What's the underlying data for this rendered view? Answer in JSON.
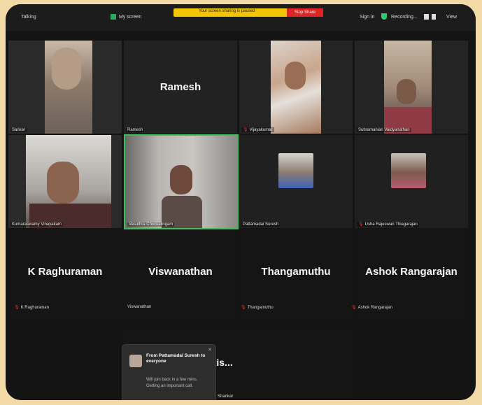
{
  "topbar": {
    "left_label": "Talking",
    "my_screen": "My screen",
    "share_notice": "Your screen sharing is paused",
    "stop_button": "Stop Share",
    "sign_in": "Sign in",
    "recording": "Recording...",
    "view": "View"
  },
  "row1": {
    "sankar": "Sankar",
    "ramesh_big": "Ramesh",
    "ramesh": "Ramesh",
    "vijayakumar": "Vijayakumar",
    "subramanian": "Subramanian Vaidyanathan"
  },
  "row2": {
    "kumaraswamy": "Kumaraswamy Vinayakam",
    "vasuthra": "Vasuthra Chockalingam",
    "pattamadai": "Pattamadai Suresh",
    "usha": "Usha Rajeswari Thiagarajan"
  },
  "row3": {
    "raghuraman_big": "K Raghuraman",
    "raghuraman": "K Raghuraman",
    "viswanathan_big": "Viswanathan",
    "viswanathan": "Viswanathan",
    "thangamuthu_big": "Thangamuthu",
    "thangamuthu": "Thangamuthu",
    "ashok_big": "Ashok Rangarajan",
    "ashok": "Ashok Rangarajan"
  },
  "row4": {
    "partial_big": "har  ramakris...",
    "partial": "Shankar"
  },
  "chat": {
    "from": "From Pattamadai Suresh to everyone",
    "message": "Will join back in a few mins. Getting an important call."
  },
  "colors": {
    "background": "#f3d9a5",
    "tile_bg": "#262626",
    "active_border": "#3fbf5a",
    "share_yellow": "#f2c500",
    "stop_red": "#e02424"
  }
}
